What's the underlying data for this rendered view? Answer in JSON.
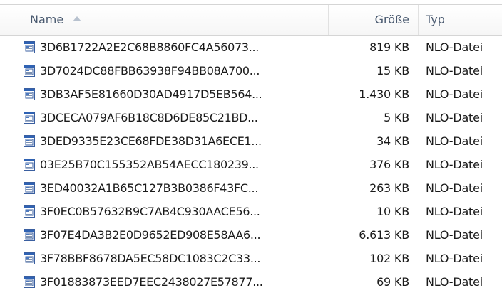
{
  "columns": {
    "name": "Name",
    "size": "Größe",
    "type": "Typ"
  },
  "icons": {
    "column_sort": "sort-ascending-icon",
    "file": "nlo-file-icon"
  },
  "files": [
    {
      "name": "3D6B1722A2E2C68B8860FC4A56073...",
      "size": "819 KB",
      "type": "NLO-Datei"
    },
    {
      "name": "3D7024DC88FBB63938F94BB08A700...",
      "size": "15 KB",
      "type": "NLO-Datei"
    },
    {
      "name": "3DB3AF5E81660D30AD4917D5EB564...",
      "size": "1.430 KB",
      "type": "NLO-Datei"
    },
    {
      "name": "3DCECA079AF6B18C8D6DE85C21BD...",
      "size": "5 KB",
      "type": "NLO-Datei"
    },
    {
      "name": "3DED9335E23CE68FDE38D31A6ECE1...",
      "size": "34 KB",
      "type": "NLO-Datei"
    },
    {
      "name": "03E25B70C155352AB54AECC180239...",
      "size": "376 KB",
      "type": "NLO-Datei"
    },
    {
      "name": "3ED40032A1B65C127B3B0386F43FC...",
      "size": "263 KB",
      "type": "NLO-Datei"
    },
    {
      "name": "3F0EC0B57632B9C7AB4C930AACE56...",
      "size": "10 KB",
      "type": "NLO-Datei"
    },
    {
      "name": "3F07E4DA3B2E0D9652ED908E58AA6...",
      "size": "6.613 KB",
      "type": "NLO-Datei"
    },
    {
      "name": "3F78BBF8678DA5EC58DC1083C2C33...",
      "size": "102 KB",
      "type": "NLO-Datei"
    },
    {
      "name": "3F01883873EED7EEC2438027E57877...",
      "size": "69 KB",
      "type": "NLO-Datei"
    }
  ]
}
